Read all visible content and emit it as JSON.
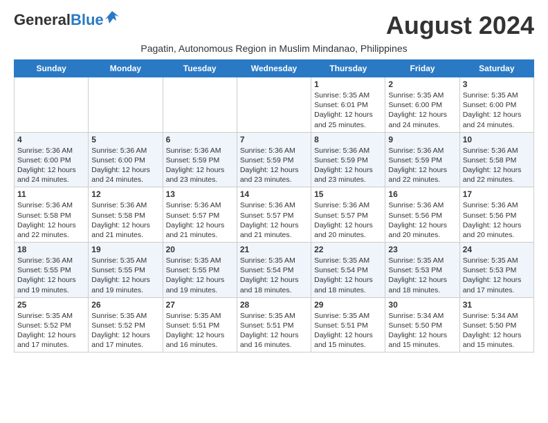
{
  "header": {
    "logo_general": "General",
    "logo_blue": "Blue",
    "month_year": "August 2024",
    "subtitle": "Pagatin, Autonomous Region in Muslim Mindanao, Philippines"
  },
  "weekdays": [
    "Sunday",
    "Monday",
    "Tuesday",
    "Wednesday",
    "Thursday",
    "Friday",
    "Saturday"
  ],
  "weeks": [
    [
      {
        "day": "",
        "info": ""
      },
      {
        "day": "",
        "info": ""
      },
      {
        "day": "",
        "info": ""
      },
      {
        "day": "",
        "info": ""
      },
      {
        "day": "1",
        "info": "Sunrise: 5:35 AM\nSunset: 6:01 PM\nDaylight: 12 hours\nand 25 minutes."
      },
      {
        "day": "2",
        "info": "Sunrise: 5:35 AM\nSunset: 6:00 PM\nDaylight: 12 hours\nand 24 minutes."
      },
      {
        "day": "3",
        "info": "Sunrise: 5:35 AM\nSunset: 6:00 PM\nDaylight: 12 hours\nand 24 minutes."
      }
    ],
    [
      {
        "day": "4",
        "info": "Sunrise: 5:36 AM\nSunset: 6:00 PM\nDaylight: 12 hours\nand 24 minutes."
      },
      {
        "day": "5",
        "info": "Sunrise: 5:36 AM\nSunset: 6:00 PM\nDaylight: 12 hours\nand 24 minutes."
      },
      {
        "day": "6",
        "info": "Sunrise: 5:36 AM\nSunset: 5:59 PM\nDaylight: 12 hours\nand 23 minutes."
      },
      {
        "day": "7",
        "info": "Sunrise: 5:36 AM\nSunset: 5:59 PM\nDaylight: 12 hours\nand 23 minutes."
      },
      {
        "day": "8",
        "info": "Sunrise: 5:36 AM\nSunset: 5:59 PM\nDaylight: 12 hours\nand 23 minutes."
      },
      {
        "day": "9",
        "info": "Sunrise: 5:36 AM\nSunset: 5:59 PM\nDaylight: 12 hours\nand 22 minutes."
      },
      {
        "day": "10",
        "info": "Sunrise: 5:36 AM\nSunset: 5:58 PM\nDaylight: 12 hours\nand 22 minutes."
      }
    ],
    [
      {
        "day": "11",
        "info": "Sunrise: 5:36 AM\nSunset: 5:58 PM\nDaylight: 12 hours\nand 22 minutes."
      },
      {
        "day": "12",
        "info": "Sunrise: 5:36 AM\nSunset: 5:58 PM\nDaylight: 12 hours\nand 21 minutes."
      },
      {
        "day": "13",
        "info": "Sunrise: 5:36 AM\nSunset: 5:57 PM\nDaylight: 12 hours\nand 21 minutes."
      },
      {
        "day": "14",
        "info": "Sunrise: 5:36 AM\nSunset: 5:57 PM\nDaylight: 12 hours\nand 21 minutes."
      },
      {
        "day": "15",
        "info": "Sunrise: 5:36 AM\nSunset: 5:57 PM\nDaylight: 12 hours\nand 20 minutes."
      },
      {
        "day": "16",
        "info": "Sunrise: 5:36 AM\nSunset: 5:56 PM\nDaylight: 12 hours\nand 20 minutes."
      },
      {
        "day": "17",
        "info": "Sunrise: 5:36 AM\nSunset: 5:56 PM\nDaylight: 12 hours\nand 20 minutes."
      }
    ],
    [
      {
        "day": "18",
        "info": "Sunrise: 5:36 AM\nSunset: 5:55 PM\nDaylight: 12 hours\nand 19 minutes."
      },
      {
        "day": "19",
        "info": "Sunrise: 5:35 AM\nSunset: 5:55 PM\nDaylight: 12 hours\nand 19 minutes."
      },
      {
        "day": "20",
        "info": "Sunrise: 5:35 AM\nSunset: 5:55 PM\nDaylight: 12 hours\nand 19 minutes."
      },
      {
        "day": "21",
        "info": "Sunrise: 5:35 AM\nSunset: 5:54 PM\nDaylight: 12 hours\nand 18 minutes."
      },
      {
        "day": "22",
        "info": "Sunrise: 5:35 AM\nSunset: 5:54 PM\nDaylight: 12 hours\nand 18 minutes."
      },
      {
        "day": "23",
        "info": "Sunrise: 5:35 AM\nSunset: 5:53 PM\nDaylight: 12 hours\nand 18 minutes."
      },
      {
        "day": "24",
        "info": "Sunrise: 5:35 AM\nSunset: 5:53 PM\nDaylight: 12 hours\nand 17 minutes."
      }
    ],
    [
      {
        "day": "25",
        "info": "Sunrise: 5:35 AM\nSunset: 5:52 PM\nDaylight: 12 hours\nand 17 minutes."
      },
      {
        "day": "26",
        "info": "Sunrise: 5:35 AM\nSunset: 5:52 PM\nDaylight: 12 hours\nand 17 minutes."
      },
      {
        "day": "27",
        "info": "Sunrise: 5:35 AM\nSunset: 5:51 PM\nDaylight: 12 hours\nand 16 minutes."
      },
      {
        "day": "28",
        "info": "Sunrise: 5:35 AM\nSunset: 5:51 PM\nDaylight: 12 hours\nand 16 minutes."
      },
      {
        "day": "29",
        "info": "Sunrise: 5:35 AM\nSunset: 5:51 PM\nDaylight: 12 hours\nand 15 minutes."
      },
      {
        "day": "30",
        "info": "Sunrise: 5:34 AM\nSunset: 5:50 PM\nDaylight: 12 hours\nand 15 minutes."
      },
      {
        "day": "31",
        "info": "Sunrise: 5:34 AM\nSunset: 5:50 PM\nDaylight: 12 hours\nand 15 minutes."
      }
    ]
  ]
}
